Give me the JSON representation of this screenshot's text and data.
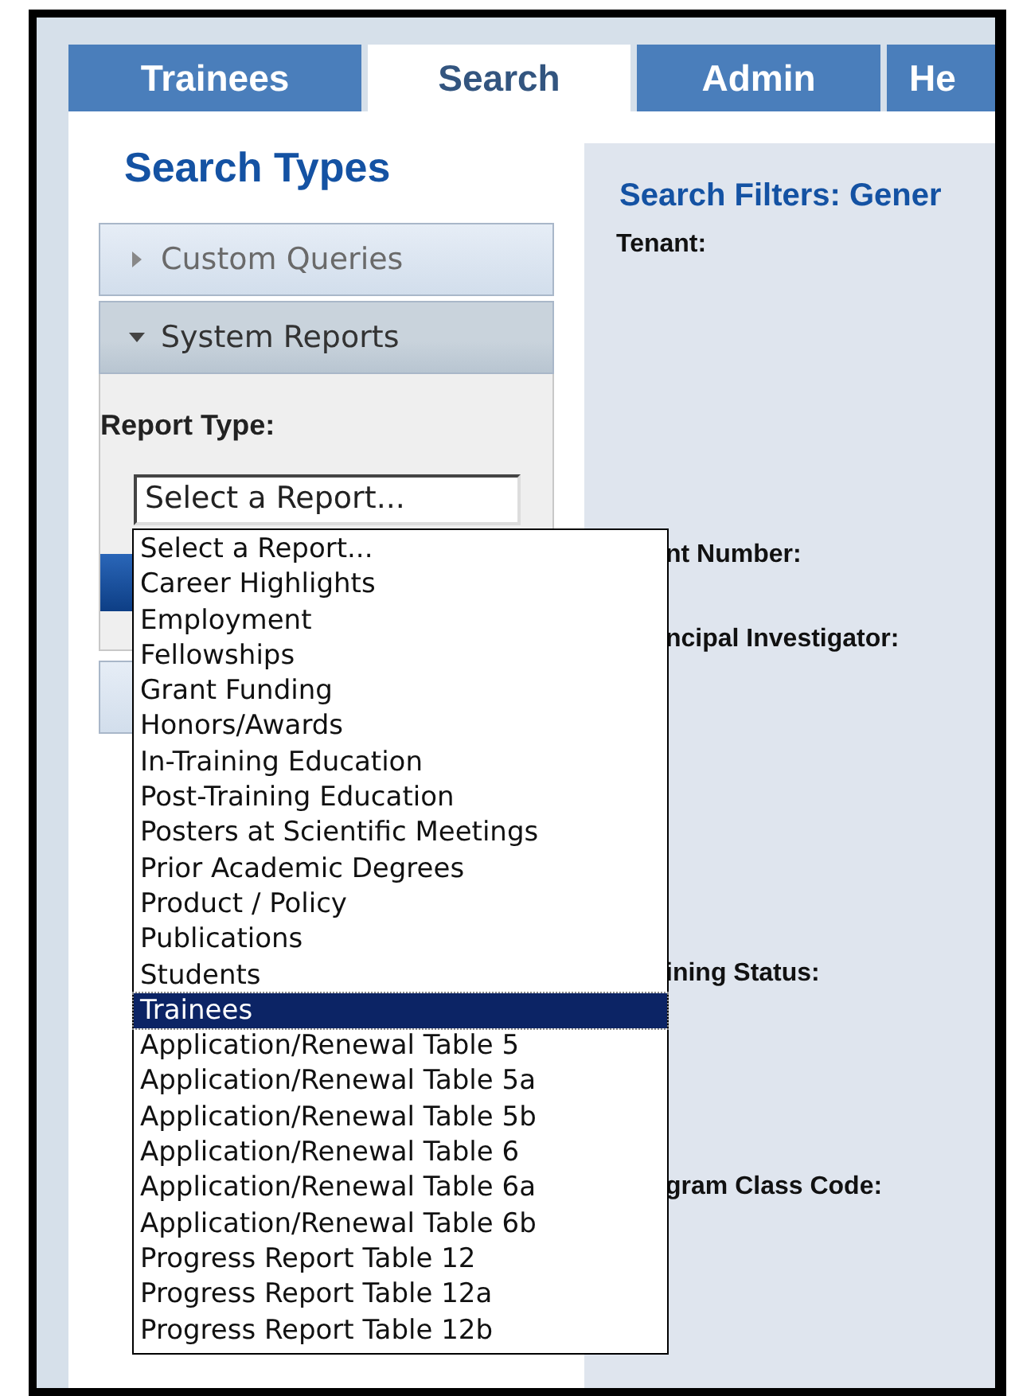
{
  "tabs": [
    {
      "label": "Trainees",
      "selected": false
    },
    {
      "label": "Search",
      "selected": true
    },
    {
      "label": "Admin",
      "selected": false
    },
    {
      "label": "He",
      "selected": false
    }
  ],
  "sidebar": {
    "title": "Search Types",
    "sections": [
      {
        "label": "Custom Queries",
        "expanded": false
      },
      {
        "label": "System Reports",
        "expanded": true
      }
    ],
    "report_type_label": "Report Type:",
    "report_select": {
      "value": "Select a Report...",
      "open": true
    },
    "report_options": [
      {
        "label": "Select a Report...",
        "selected": false
      },
      {
        "label": "Career Highlights",
        "selected": false
      },
      {
        "label": "Employment",
        "selected": false
      },
      {
        "label": "Fellowships",
        "selected": false
      },
      {
        "label": "Grant Funding",
        "selected": false
      },
      {
        "label": "Honors/Awards",
        "selected": false
      },
      {
        "label": "In-Training Education",
        "selected": false
      },
      {
        "label": "Post-Training Education",
        "selected": false
      },
      {
        "label": "Posters at Scientific Meetings",
        "selected": false
      },
      {
        "label": "Prior Academic Degrees",
        "selected": false
      },
      {
        "label": "Product / Policy",
        "selected": false
      },
      {
        "label": "Publications",
        "selected": false
      },
      {
        "label": "Students",
        "selected": false
      },
      {
        "label": "Trainees",
        "selected": true
      },
      {
        "label": "Application/Renewal Table 5",
        "selected": false
      },
      {
        "label": "Application/Renewal Table 5a",
        "selected": false
      },
      {
        "label": "Application/Renewal Table 5b",
        "selected": false
      },
      {
        "label": "Application/Renewal Table 6",
        "selected": false
      },
      {
        "label": "Application/Renewal Table 6a",
        "selected": false
      },
      {
        "label": "Application/Renewal Table 6b",
        "selected": false
      },
      {
        "label": "Progress Report Table 12",
        "selected": false
      },
      {
        "label": "Progress Report Table 12a",
        "selected": false
      },
      {
        "label": "Progress Report Table 12b",
        "selected": false
      }
    ]
  },
  "filters": {
    "title": "Search Filters: Gener",
    "labels": [
      "Tenant:",
      "nt Number:",
      "ncipal Investigator:",
      "ining Status:",
      "gram Class Code:"
    ]
  }
}
